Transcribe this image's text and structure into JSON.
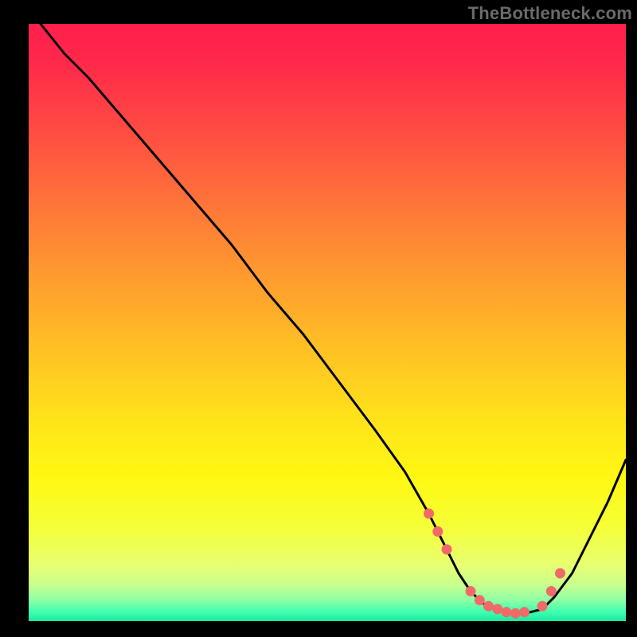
{
  "watermark": "TheBottleneck.com",
  "colors": {
    "black": "#000000",
    "marker": "#f06a6a",
    "curve": "#000000"
  },
  "chart_data": {
    "type": "line",
    "title": "",
    "xlabel": "",
    "ylabel": "",
    "xlim": [
      0,
      100
    ],
    "ylim": [
      0,
      100
    ],
    "background_gradient_stops": [
      {
        "pos": 0.0,
        "color": "#ff1f4c"
      },
      {
        "pos": 0.07,
        "color": "#ff2a4a"
      },
      {
        "pos": 0.18,
        "color": "#ff4c43"
      },
      {
        "pos": 0.3,
        "color": "#ff7439"
      },
      {
        "pos": 0.42,
        "color": "#ff9a2f"
      },
      {
        "pos": 0.54,
        "color": "#ffbf24"
      },
      {
        "pos": 0.66,
        "color": "#ffe21a"
      },
      {
        "pos": 0.76,
        "color": "#fff812"
      },
      {
        "pos": 0.84,
        "color": "#f5ff36"
      },
      {
        "pos": 0.905,
        "color": "#e8ff70"
      },
      {
        "pos": 0.94,
        "color": "#c7ff8e"
      },
      {
        "pos": 0.965,
        "color": "#8dffa6"
      },
      {
        "pos": 0.985,
        "color": "#3fffaf"
      },
      {
        "pos": 1.0,
        "color": "#18e8a0"
      }
    ],
    "series": [
      {
        "name": "bottleneck-curve",
        "x": [
          2,
          6,
          10,
          16,
          22,
          28,
          34,
          40,
          46,
          52,
          58,
          63,
          67,
          70,
          72,
          74,
          76,
          78,
          80,
          82,
          84,
          86,
          88,
          91,
          94,
          97,
          100
        ],
        "y": [
          100,
          95,
          91,
          84,
          77,
          70,
          63,
          55,
          48,
          40,
          32,
          25,
          18,
          12,
          8,
          5,
          3,
          2,
          1.5,
          1.2,
          1.5,
          2,
          4,
          8,
          14,
          20,
          27
        ]
      }
    ],
    "markers": {
      "name": "highlight-dots",
      "x": [
        67,
        68.5,
        70,
        74,
        75.5,
        77,
        78.5,
        80,
        81.5,
        83,
        86,
        87.5,
        89
      ],
      "y": [
        18,
        15,
        12,
        5,
        3.5,
        2.5,
        2,
        1.5,
        1.3,
        1.5,
        2.5,
        5,
        8
      ]
    }
  }
}
